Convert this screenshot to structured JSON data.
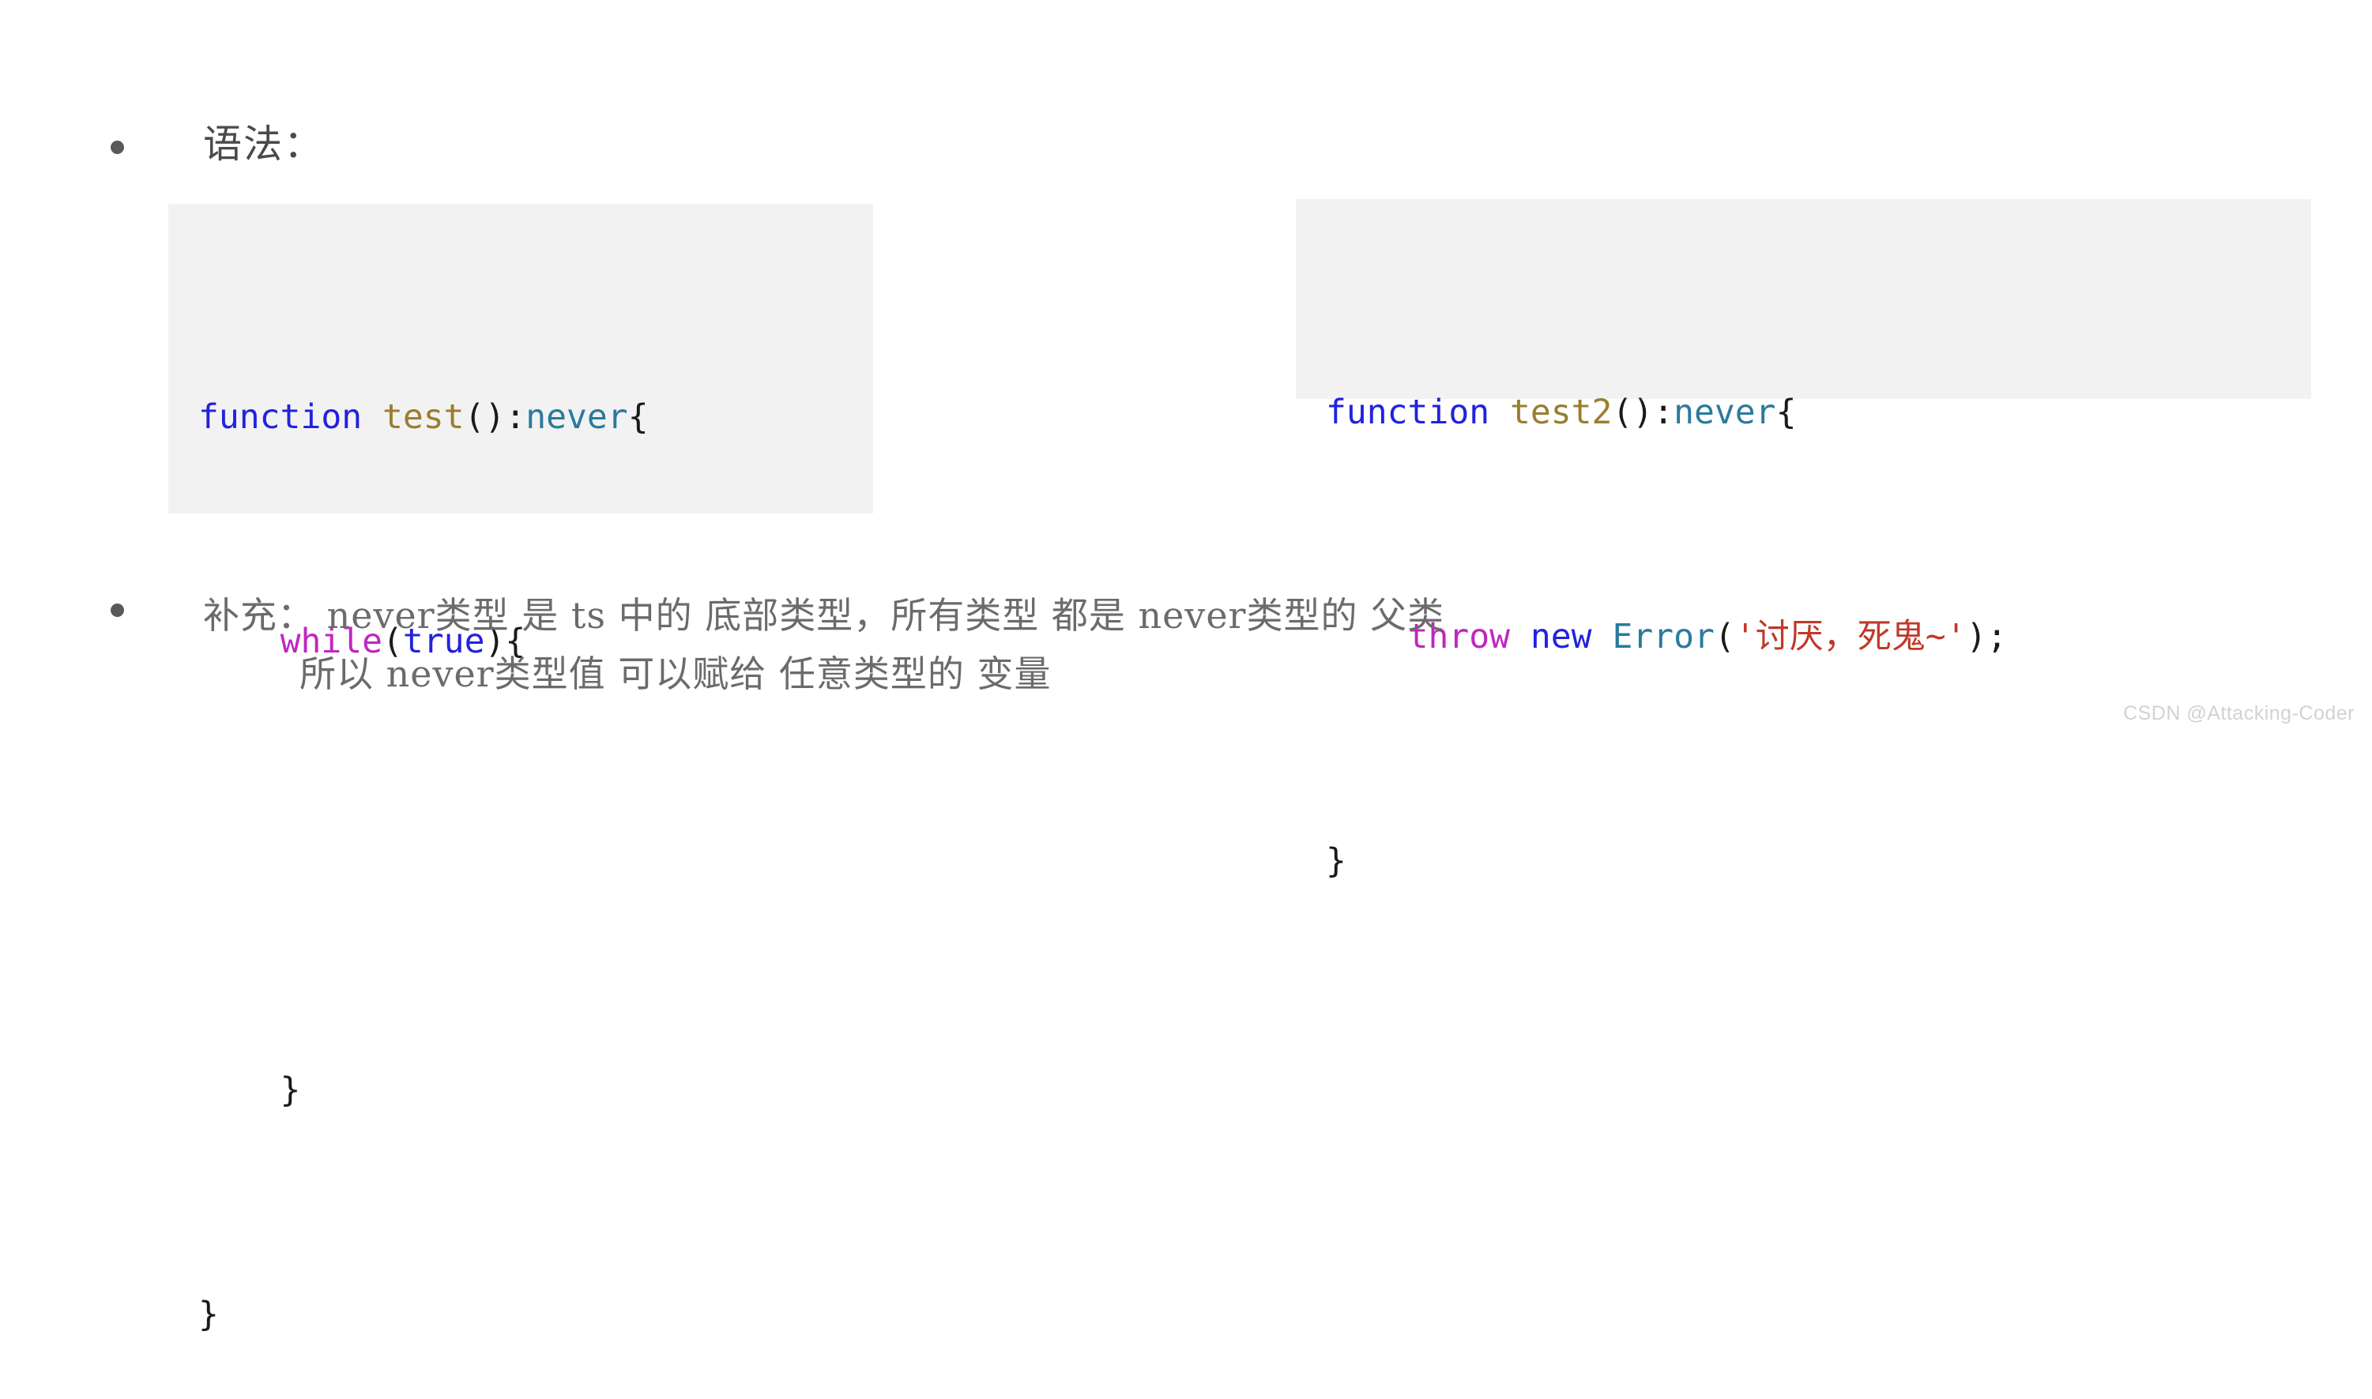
{
  "slide": {
    "background_color": "#ffffff",
    "sections": [
      {
        "bullet_label": "语法：",
        "bullet_marker": "bullet-dot"
      },
      {
        "bullet_label": "补充：",
        "bullet_marker": "bullet-dot"
      }
    ]
  },
  "headings": {
    "syntax": "语法：",
    "supplement_prefix": "补充："
  },
  "code_blocks": [
    {
      "id": "code-block-1",
      "language": "typescript",
      "background_color": "#f2f2f2",
      "raw_text": "function test():never{\n    while(true){\n\n    }\n}",
      "lines": [
        {
          "tokens": [
            {
              "text": "function",
              "kind": "keyword",
              "color": "#2222dd"
            },
            {
              "text": " ",
              "kind": "plain",
              "color": "#1a1a1a"
            },
            {
              "text": "test",
              "kind": "function-name",
              "color": "#9a7d2e"
            },
            {
              "text": "():",
              "kind": "punctuation",
              "color": "#1a1a1a"
            },
            {
              "text": "never",
              "kind": "type",
              "color": "#2b7a9e"
            },
            {
              "text": "{",
              "kind": "punctuation",
              "color": "#1a1a1a"
            }
          ]
        },
        {
          "tokens": [
            {
              "text": "    ",
              "kind": "plain",
              "color": "#1a1a1a"
            },
            {
              "text": "while",
              "kind": "control",
              "color": "#c026c0"
            },
            {
              "text": "(",
              "kind": "punctuation",
              "color": "#1a1a1a"
            },
            {
              "text": "true",
              "kind": "keyword",
              "color": "#2222dd"
            },
            {
              "text": "){",
              "kind": "punctuation",
              "color": "#1a1a1a"
            }
          ]
        },
        {
          "tokens": []
        },
        {
          "tokens": [
            {
              "text": "    }",
              "kind": "punctuation",
              "color": "#1a1a1a"
            }
          ]
        },
        {
          "tokens": [
            {
              "text": "}",
              "kind": "punctuation",
              "color": "#1a1a1a"
            }
          ]
        }
      ]
    },
    {
      "id": "code-block-2",
      "language": "typescript",
      "background_color": "#f2f2f2",
      "raw_text": "function test2():never{\n    throw new Error('讨厌，死鬼~');\n}",
      "lines": [
        {
          "tokens": [
            {
              "text": "function",
              "kind": "keyword",
              "color": "#2222dd"
            },
            {
              "text": " ",
              "kind": "plain",
              "color": "#1a1a1a"
            },
            {
              "text": "test2",
              "kind": "function-name",
              "color": "#9a7d2e"
            },
            {
              "text": "():",
              "kind": "punctuation",
              "color": "#1a1a1a"
            },
            {
              "text": "never",
              "kind": "type",
              "color": "#2b7a9e"
            },
            {
              "text": "{",
              "kind": "punctuation",
              "color": "#1a1a1a"
            }
          ]
        },
        {
          "tokens": [
            {
              "text": "    ",
              "kind": "plain",
              "color": "#1a1a1a"
            },
            {
              "text": "throw",
              "kind": "control",
              "color": "#c026c0"
            },
            {
              "text": " ",
              "kind": "plain",
              "color": "#1a1a1a"
            },
            {
              "text": "new",
              "kind": "keyword",
              "color": "#2222dd"
            },
            {
              "text": " ",
              "kind": "plain",
              "color": "#1a1a1a"
            },
            {
              "text": "Error",
              "kind": "type",
              "color": "#2b7a9e"
            },
            {
              "text": "(",
              "kind": "punctuation",
              "color": "#1a1a1a"
            },
            {
              "text": "'讨厌，死鬼~'",
              "kind": "string",
              "color": "#c0392b"
            },
            {
              "text": ");",
              "kind": "punctuation",
              "color": "#1a1a1a"
            }
          ]
        },
        {
          "tokens": [
            {
              "text": "}",
              "kind": "punctuation",
              "color": "#1a1a1a"
            }
          ]
        }
      ]
    }
  ],
  "supplement": {
    "line1": "补充： never类型 是 ts 中的 底部类型，所有类型 都是 never类型的 父类",
    "line2": "所以 never类型值 可以赋给 任意类型的 变量"
  },
  "watermark": {
    "text": "CSDN @Attacking-Coder",
    "color": "#d2d2d2"
  }
}
